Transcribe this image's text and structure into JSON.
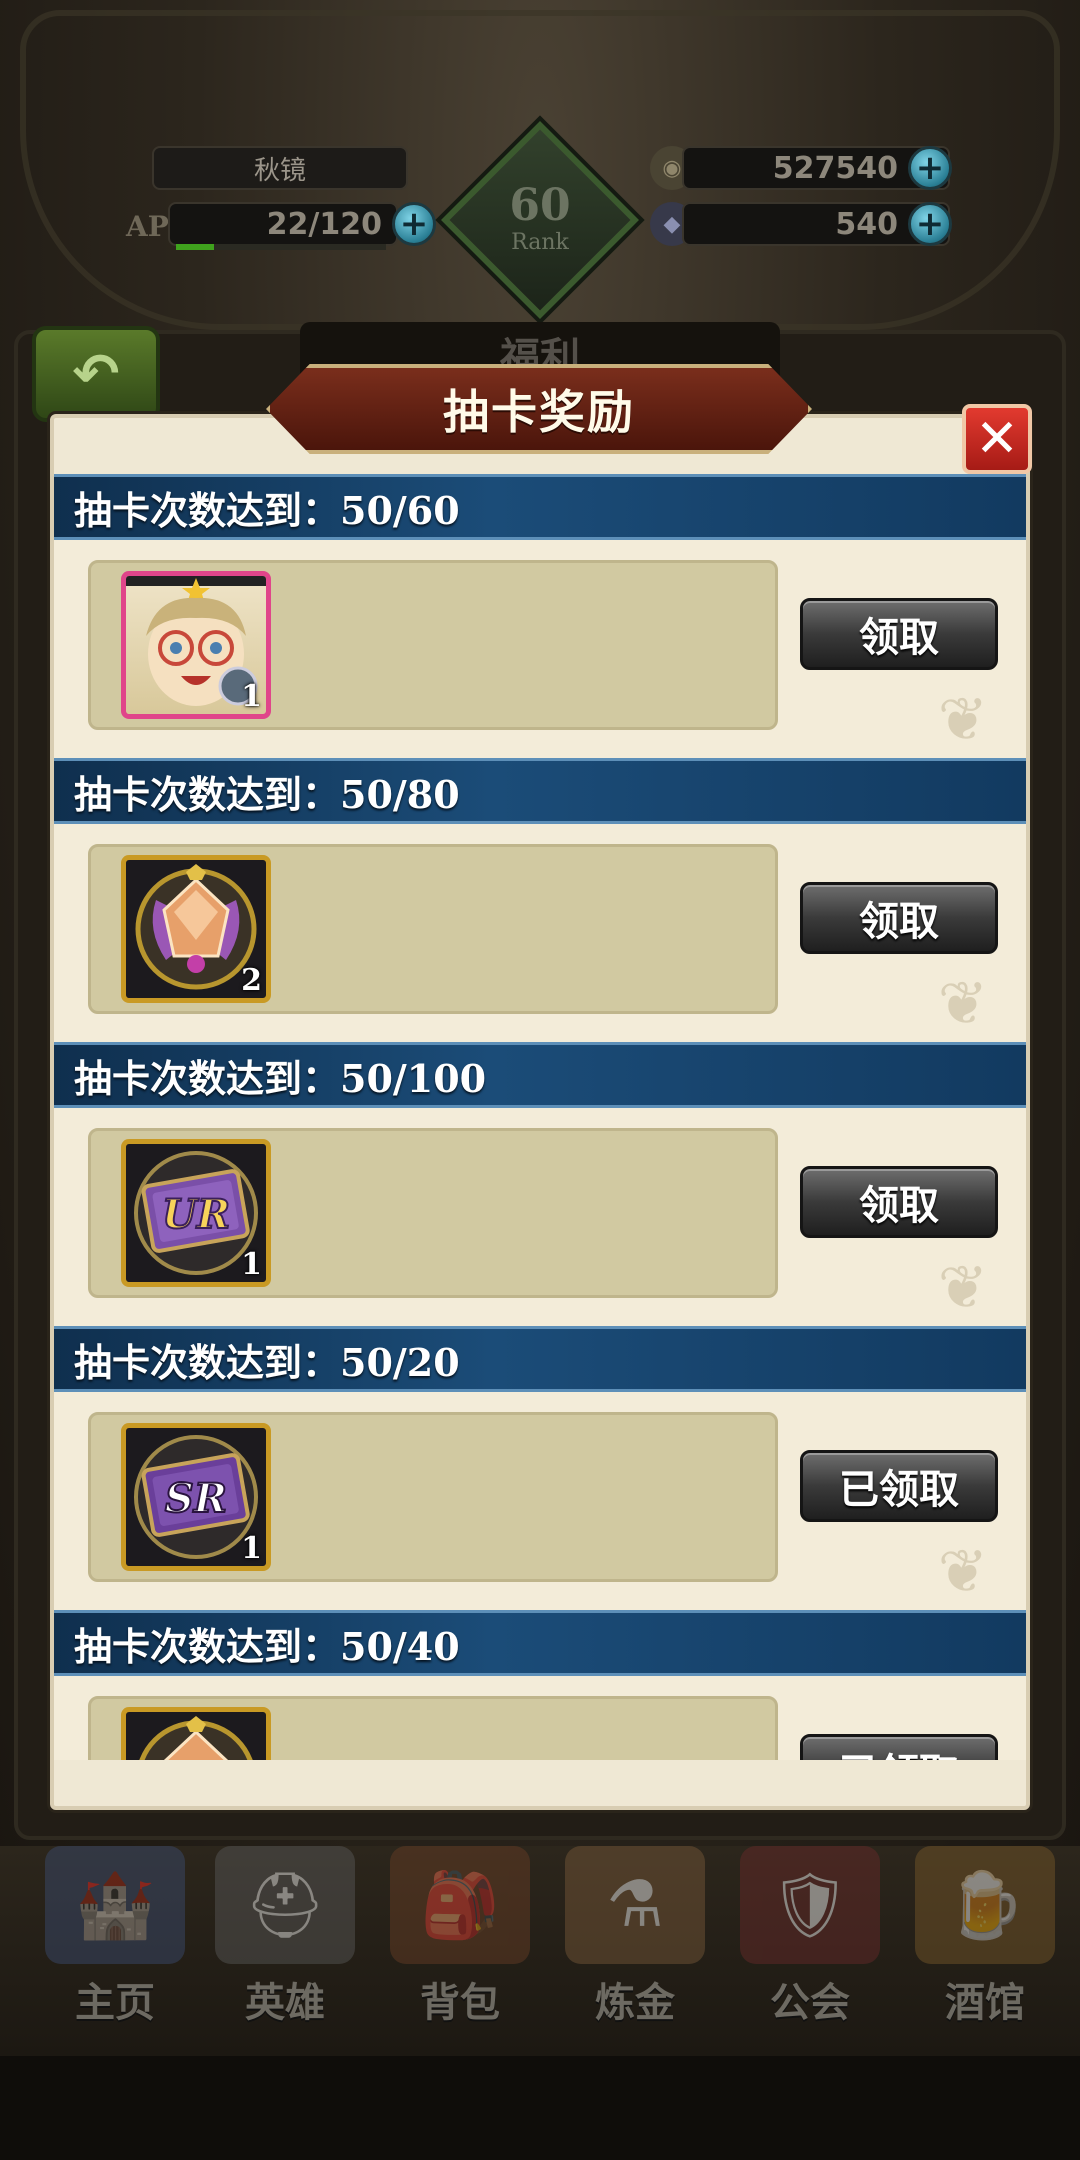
{
  "header": {
    "player_name": "秋镜",
    "ap_label": "AP",
    "ap_value": "22/120",
    "ap_fill": 0.18,
    "rank_value": "60",
    "rank_label": "Rank",
    "gold_value": "527540",
    "gem_value": "540",
    "behind_title": "福利"
  },
  "modal": {
    "title": "抽卡奖励",
    "close_icon": "close-icon"
  },
  "rewards": [
    {
      "requirement": "抽卡次数达到：50/60",
      "item": "hero-portrait-icon",
      "qty": "1",
      "button": "领取"
    },
    {
      "requirement": "抽卡次数达到：50/80",
      "item": "crystal-emblem-icon",
      "qty": "2",
      "button": "领取"
    },
    {
      "requirement": "抽卡次数达到：50/100",
      "item": "ur-ticket-icon",
      "ticket_text": "UR",
      "qty": "1",
      "button": "领取"
    },
    {
      "requirement": "抽卡次数达到：50/20",
      "item": "sr-ticket-icon",
      "ticket_text": "SR",
      "qty": "1",
      "button": "已领取"
    },
    {
      "requirement": "抽卡次数达到：50/40",
      "item": "crystal-emblem-icon",
      "qty": "",
      "button": "已领取"
    }
  ],
  "nav": [
    {
      "label": "主页",
      "icon": "castle-icon"
    },
    {
      "label": "英雄",
      "icon": "hero-helmet-icon"
    },
    {
      "label": "背包",
      "icon": "backpack-icon"
    },
    {
      "label": "炼金",
      "icon": "alchemy-flask-icon"
    },
    {
      "label": "公会",
      "icon": "guild-shield-icon"
    },
    {
      "label": "酒馆",
      "icon": "tavern-icon"
    }
  ],
  "colors": {
    "header_blue": "#1b4c78",
    "modal_bg": "#efe8d4",
    "item_frame": "#d1c9a1",
    "title_red": "#7a2e1c",
    "close_red": "#e23a2f"
  }
}
